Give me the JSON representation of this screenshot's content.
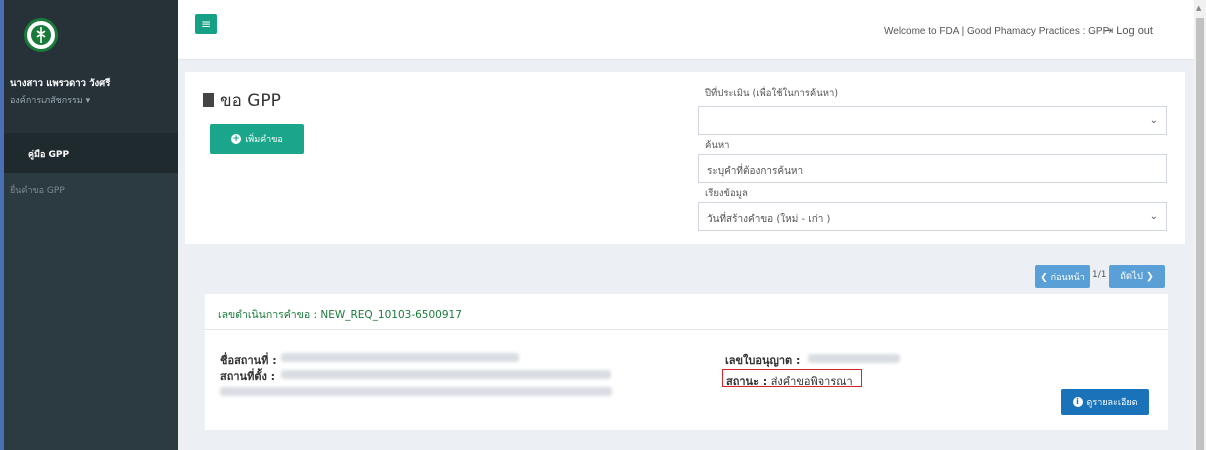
{
  "sidebar": {
    "user_name": "นางสาว แพรวดาว วังศรี",
    "user_org": "องค์การเภสัชกรรม ▾",
    "items": [
      {
        "label": "คู่มือ GPP"
      },
      {
        "label": "ยื่นคำขอ GPP"
      }
    ]
  },
  "topbar": {
    "menu_icon": "≡",
    "welcome": "Welcome to FDA | Good Phamacy Practices : GPP",
    "logout": "Log out"
  },
  "page": {
    "title": "ขอ GPP",
    "add_button": "เพิ่มคำขอ"
  },
  "filters": {
    "year_label": "ปีที่ประเมิน (เพื่อใช้ในการค้นหา)",
    "search_label": "ค้นหา",
    "search_placeholder": "ระบุคำที่ต้องการค้นหา",
    "sort_label": "เรียงข้อมูล",
    "sort_value": "วันที่สร้างคำขอ (ใหม่ - เก่า )"
  },
  "pager": {
    "prev": "❮ ก่อนหน้า",
    "current": "1/1",
    "next": "ถัดไป ❯"
  },
  "request": {
    "title": "เลขดำเนินการคำขอ : NEW_REQ_10103-6500917",
    "place_name_label": "ชื่อสถานที่ :",
    "location_label": "สถานที่ตั้ง :",
    "license_label": "เลขใบอนุญาต :",
    "status_label": "สถานะ :",
    "status_value": "ส่งคำขอพิจารณา",
    "detail_button": "ดูรายละเอียด"
  },
  "colors": {
    "sidebar_bg": "#2c3b41",
    "accent_green": "#1aa68a",
    "accent_blue": "#1a73b8",
    "status_border": "#d9262c"
  }
}
